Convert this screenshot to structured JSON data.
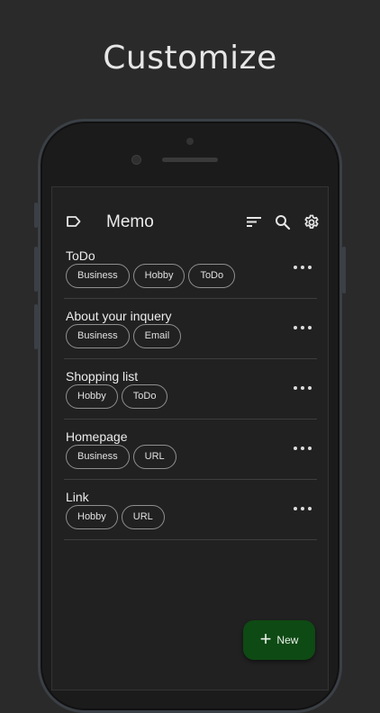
{
  "headline": "Customize",
  "appbar": {
    "title": "Memo",
    "icons": [
      "label-icon",
      "sort-icon",
      "search-icon",
      "settings-icon"
    ]
  },
  "memos": [
    {
      "title": "ToDo",
      "tags": [
        "Business",
        "Hobby",
        "ToDo"
      ]
    },
    {
      "title": "About your inquery",
      "tags": [
        "Business",
        "Email"
      ]
    },
    {
      "title": "Shopping list",
      "tags": [
        "Hobby",
        "ToDo"
      ]
    },
    {
      "title": "Homepage",
      "tags": [
        "Business",
        "URL"
      ]
    },
    {
      "title": "Link",
      "tags": [
        "Hobby",
        "URL"
      ]
    }
  ],
  "fab": {
    "icon": "plus-icon",
    "label": "New"
  },
  "colors": {
    "background": "#2a2a2a",
    "screen": "#212121",
    "fab": "#0e4a14",
    "chip_border": "#8f8f8f"
  }
}
